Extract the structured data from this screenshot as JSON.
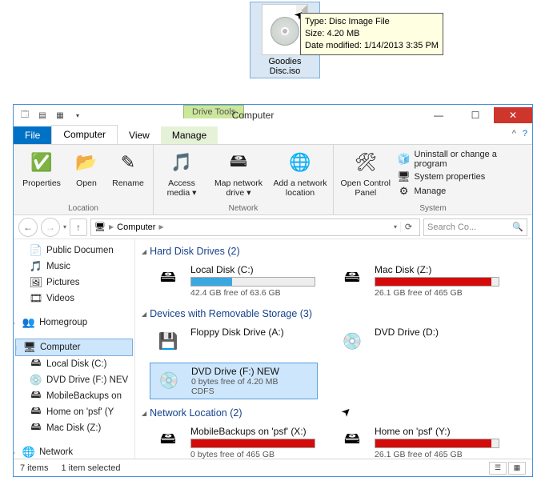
{
  "desktop": {
    "filename": "Goodies Disc.iso",
    "tooltip": {
      "l1": "Type: Disc Image File",
      "l2": "Size: 4.20 MB",
      "l3": "Date modified: 1/14/2013 3:35 PM"
    }
  },
  "window": {
    "drive_tools_label": "Drive Tools",
    "title": "Computer",
    "tabs": {
      "file": "File",
      "computer": "Computer",
      "view": "View",
      "manage": "Manage"
    },
    "ribbon": {
      "location": {
        "properties": "Properties",
        "open": "Open",
        "rename": "Rename",
        "group_label": "Location"
      },
      "network": {
        "access_media": "Access media ▾",
        "map_drive": "Map network drive ▾",
        "add_loc": "Add a network location",
        "group_label": "Network"
      },
      "system": {
        "control_panel": "Open Control Panel",
        "uninstall": "Uninstall or change a program",
        "sysprops": "System properties",
        "manage": "Manage",
        "group_label": "System"
      }
    },
    "address": {
      "segment1": "Computer",
      "search_placeholder": "Search Co..."
    },
    "sidebar": {
      "public_documents": "Public Documen",
      "music": "Music",
      "pictures": "Pictures",
      "videos": "Videos",
      "homegroup": "Homegroup",
      "computer": "Computer",
      "local_disk": "Local Disk (C:)",
      "dvd_drive": "DVD Drive (F:) NEV",
      "mobilebackups": "MobileBackups on",
      "home_psf": "Home on 'psf' (Y",
      "mac_disk": "Mac Disk (Z:)",
      "network": "Network"
    },
    "cats": {
      "hdd": "Hard Disk Drives (2)",
      "removable": "Devices with Removable Storage (3)",
      "netloc": "Network Location (2)"
    },
    "drives": {
      "c": {
        "name": "Local Disk (C:)",
        "free": "42.4 GB free of 63.6 GB",
        "fill_pct": 33,
        "fill_color": "#3aa7e0"
      },
      "z": {
        "name": "Mac Disk (Z:)",
        "free": "26.1 GB free of 465 GB",
        "fill_pct": 94,
        "fill_color": "#d40b0b"
      },
      "a": {
        "name": "Floppy Disk Drive (A:)"
      },
      "d": {
        "name": "DVD Drive (D:)"
      },
      "f": {
        "name": "DVD Drive (F:) NEW",
        "free": "0 bytes free of 4.20 MB",
        "fs": "CDFS"
      },
      "x": {
        "name": "MobileBackups on 'psf' (X:)",
        "free": "0 bytes free of 465 GB",
        "fill_pct": 100,
        "fill_color": "#d40b0b"
      },
      "y": {
        "name": "Home on 'psf' (Y:)",
        "free": "26.1 GB free of 465 GB",
        "fill_pct": 94,
        "fill_color": "#d40b0b"
      }
    },
    "status": {
      "items": "7 items",
      "selected": "1 item selected"
    }
  }
}
